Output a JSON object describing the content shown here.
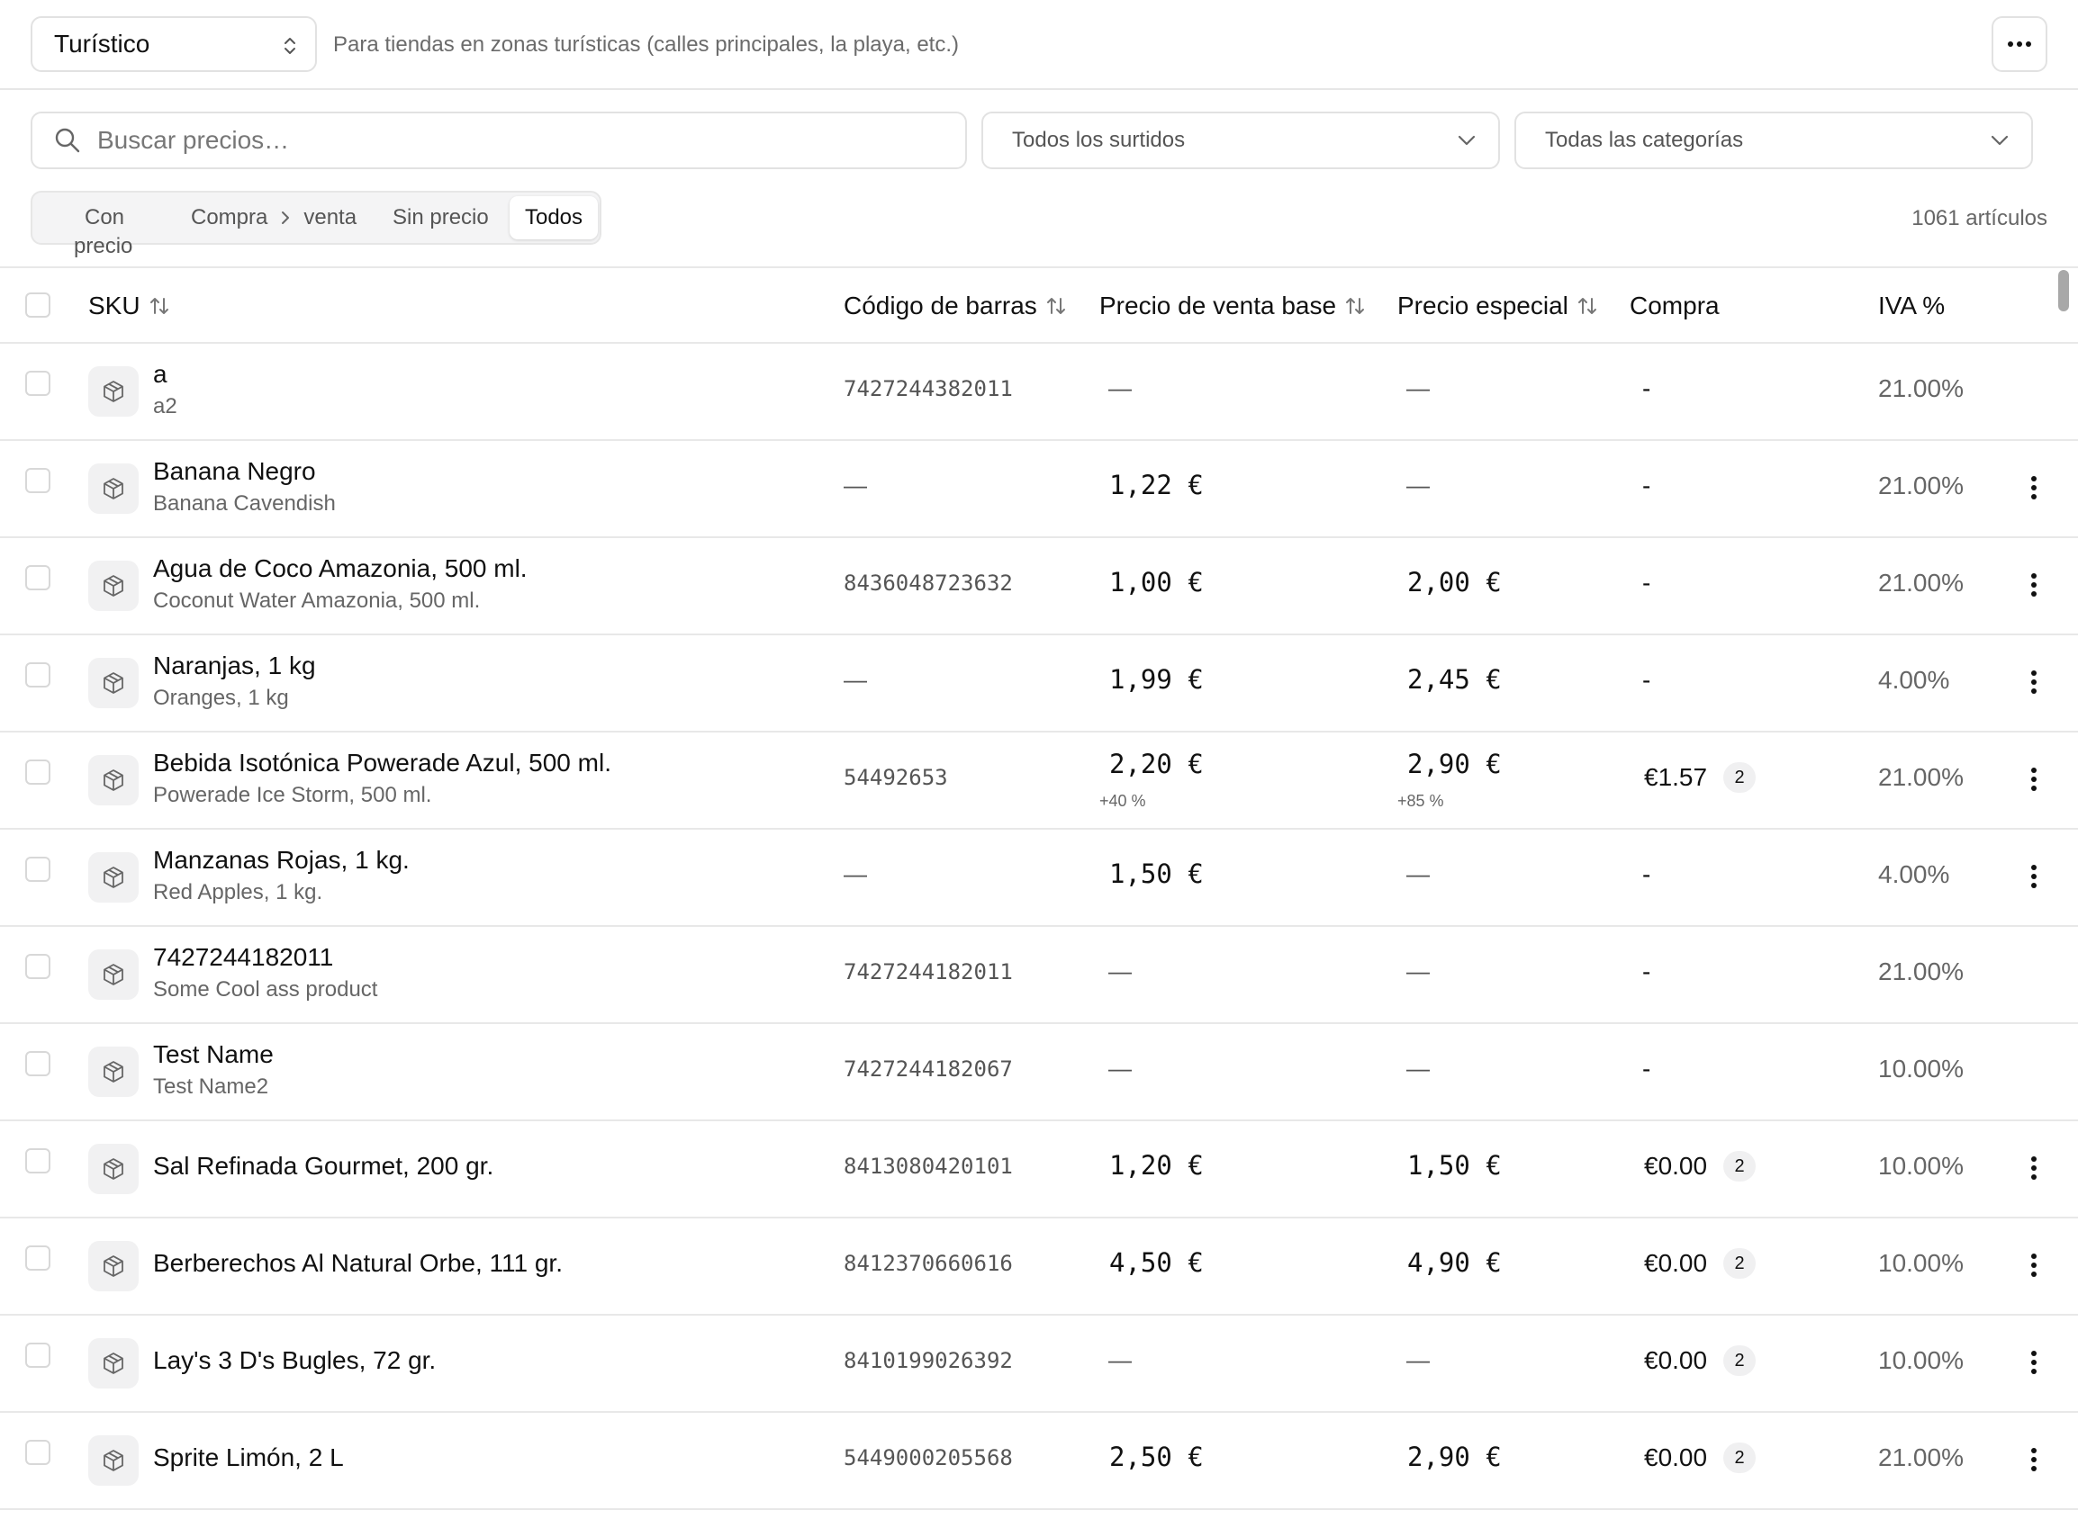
{
  "header": {
    "preset": "Turístico",
    "preset_description": "Para tiendas en zonas turísticas (calles principales, la playa, etc.)",
    "more_icon": "more-horizontal-icon"
  },
  "filters": {
    "search_placeholder": "Buscar precios…",
    "surtidos": "Todos los surtidos",
    "categorias": "Todas las categorías"
  },
  "segments": {
    "con_precio_1": "Con",
    "con_precio_2": "precio",
    "compra": "Compra",
    "venta": "venta",
    "sin_precio": "Sin precio",
    "todos": "Todos",
    "active": "Todos"
  },
  "count": "1061 artículos",
  "columns": {
    "sku": "SKU",
    "barcode": "Código de barras",
    "base_price": "Precio de venta base",
    "special_price": "Precio especial",
    "purchase": "Compra",
    "vat": "IVA %"
  },
  "rows": [
    {
      "name": "a",
      "sub": "a2",
      "barcode": "7427244382011",
      "base": "—",
      "special": "—",
      "buy": "-",
      "iva": "21.00%",
      "menu": false
    },
    {
      "name": "Banana Negro",
      "sub": "Banana Cavendish",
      "barcode": "—",
      "base": "1,22 €",
      "special": "—",
      "buy": "-",
      "iva": "21.00%",
      "menu": true
    },
    {
      "name": "Agua de Coco Amazonia, 500 ml.",
      "sub": "Coconut Water Amazonia, 500 ml.",
      "barcode": "8436048723632",
      "base": "1,00 €",
      "special": "2,00 €",
      "buy": "-",
      "iva": "21.00%",
      "menu": true
    },
    {
      "name": "Naranjas, 1 kg",
      "sub": "Oranges, 1 kg",
      "barcode": "—",
      "base": "1,99 €",
      "special": "2,45 €",
      "buy": "-",
      "iva": "4.00%",
      "menu": true
    },
    {
      "name": "Bebida Isotónica Powerade Azul, 500 ml.",
      "sub": "Powerade Ice Storm, 500 ml.",
      "barcode": "54492653",
      "base": "2,20 €",
      "base_markup": "+40 %",
      "special": "2,90 €",
      "special_markup": "+85 %",
      "buy": "€1.57",
      "buy_badge": "2",
      "iva": "21.00%",
      "menu": true
    },
    {
      "name": "Manzanas Rojas, 1 kg.",
      "sub": "Red Apples, 1 kg.",
      "barcode": "—",
      "base": "1,50 €",
      "special": "—",
      "buy": "-",
      "iva": "4.00%",
      "menu": true
    },
    {
      "name": "7427244182011",
      "sub": "Some Cool ass product",
      "barcode": "7427244182011",
      "base": "—",
      "special": "—",
      "buy": "-",
      "iva": "21.00%",
      "menu": false
    },
    {
      "name": "Test Name",
      "sub": "Test Name2",
      "barcode": "7427244182067",
      "base": "—",
      "special": "—",
      "buy": "-",
      "iva": "10.00%",
      "menu": false
    },
    {
      "name": "Sal Refinada Gourmet, 200 gr.",
      "sub": "",
      "barcode": "8413080420101",
      "base": "1,20 €",
      "special": "1,50 €",
      "buy": "€0.00",
      "buy_badge": "2",
      "iva": "10.00%",
      "menu": true
    },
    {
      "name": "Berberechos Al Natural Orbe, 111 gr.",
      "sub": "",
      "barcode": "8412370660616",
      "base": "4,50 €",
      "special": "4,90 €",
      "buy": "€0.00",
      "buy_badge": "2",
      "iva": "10.00%",
      "menu": true
    },
    {
      "name": "Lay's 3 D's Bugles, 72 gr.",
      "sub": "",
      "barcode": "8410199026392",
      "base": "—",
      "special": "—",
      "buy": "€0.00",
      "buy_badge": "2",
      "iva": "10.00%",
      "menu": true
    },
    {
      "name": "Sprite Limón, 2 L",
      "sub": "",
      "barcode": "5449000205568",
      "base": "2,50 €",
      "special": "2,90 €",
      "buy": "€0.00",
      "buy_badge": "2",
      "iva": "21.00%",
      "menu": true
    }
  ]
}
